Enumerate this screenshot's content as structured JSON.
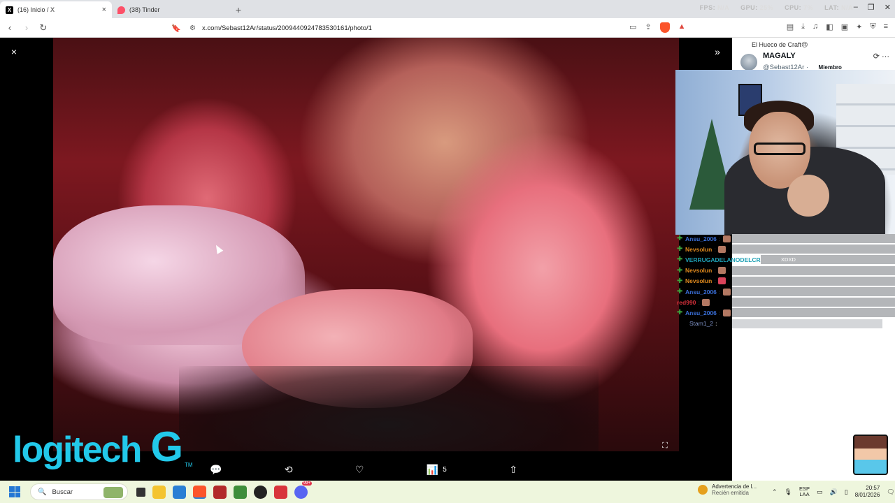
{
  "browser": {
    "tabs": [
      {
        "label": "(16) Inicio / X",
        "favicon": "x-logo",
        "active": true
      },
      {
        "label": "(38) Tinder",
        "favicon": "tinder-flame",
        "active": false
      }
    ],
    "stats": {
      "fps_label": "FPS:",
      "fps_value": "N/A",
      "gpu_label": "GPU:",
      "gpu_value": "25%",
      "cpu_label": "CPU:",
      "cpu_value": "7%",
      "lat_label": "LAT:",
      "lat_value": "N/A"
    },
    "url": "x.com/Sebast12Ar/status/2009440924783530161/photo/1",
    "brave_badge": "1"
  },
  "viewer": {
    "close_icon": "×",
    "expand_icon": "»",
    "actions": {
      "reply_icon": "💬",
      "repost_icon": "⟲",
      "like_icon": "♡",
      "views_icon": "📊",
      "views_count": "5",
      "share_icon": "⇧"
    },
    "logo": {
      "word": "logitech",
      "g": "G",
      "tm": "TM"
    }
  },
  "tweet": {
    "community": "El Hueco de Craft😢",
    "author_name": "MAGALY",
    "author_handle": "@Sebast12Ar ·",
    "badge": "Miembro"
  },
  "chat": [
    {
      "user": "Ansu_2006",
      "color": "blue",
      "text": ""
    },
    {
      "user": "Nevsolun",
      "color": "orange",
      "text": ""
    },
    {
      "user": "VERRUGADELANODELCRAFT",
      "color": "blue",
      "text": "XDXD"
    },
    {
      "user": "Nevsolun",
      "color": "orange",
      "text": ""
    },
    {
      "user": "Nevsolun",
      "color": "orange",
      "text": ""
    },
    {
      "user": "Ansu_2006",
      "color": "blue",
      "text": ""
    },
    {
      "user": "red990",
      "color": "red",
      "text": ""
    },
    {
      "user": "Ansu_2006",
      "color": "blue",
      "text": ""
    },
    {
      "user": "Stam1_2",
      "color": "faint",
      "text": ""
    }
  ],
  "taskbar": {
    "search_placeholder": "Buscar",
    "notification_title": "Advertencia de l...",
    "notification_sub": "Recién emitida",
    "lang_top": "ESP",
    "lang_bottom": "LAA",
    "time": "20:57",
    "date": "8/01/2026",
    "discord_badge": "99+"
  },
  "colors": {
    "accent_logo": "#22c9ea",
    "taskbar_bg": "#eef6dd",
    "chat_bar": "#b4b6b9"
  }
}
